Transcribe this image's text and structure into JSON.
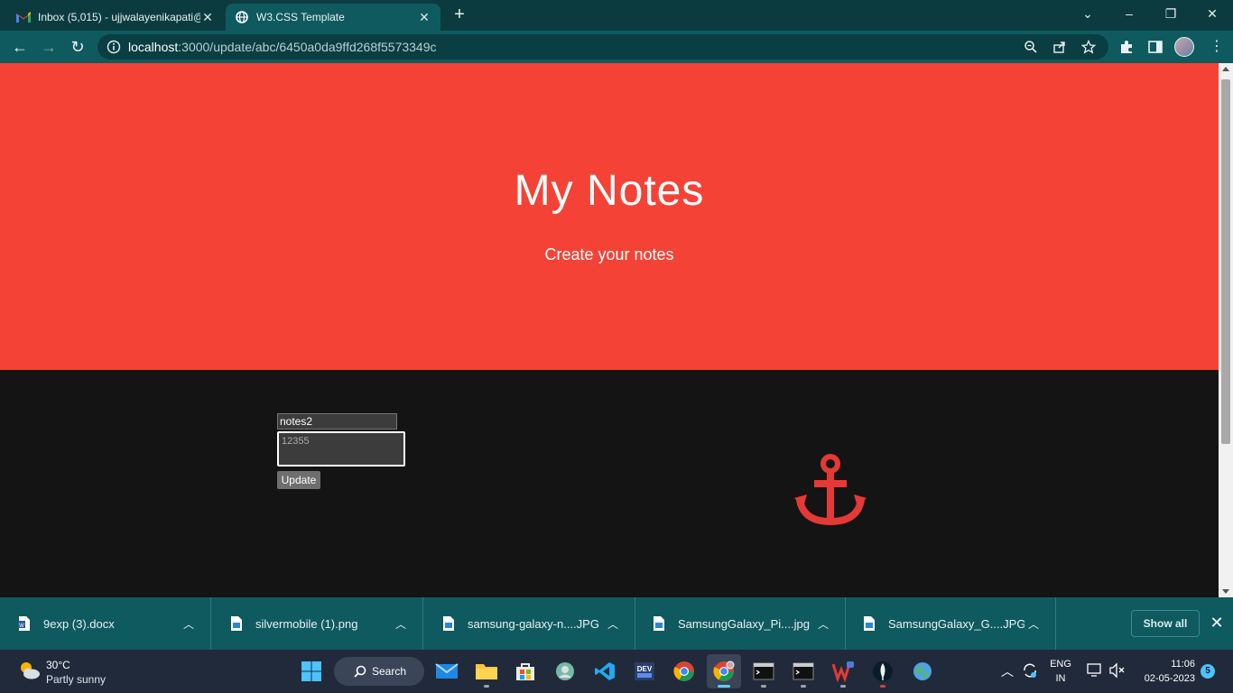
{
  "browser": {
    "tabs": [
      {
        "title": "Inbox (5,015) - ujjwalayenikapati@",
        "favicon": "gmail-icon",
        "active": false
      },
      {
        "title": "W3.CSS Template",
        "favicon": "globe-icon",
        "active": true
      }
    ],
    "url_host": "localhost",
    "url_path": ":3000/update/abc/6450a0da9ffd268f5573349c"
  },
  "page": {
    "hero_title": "My Notes",
    "hero_subtitle": "Create your notes",
    "colors": {
      "hero": "#f44336",
      "content_bg": "#141414",
      "anchor": "#e53935"
    },
    "form": {
      "title_value": "notes2",
      "body_placeholder": "12355",
      "update_label": "Update"
    },
    "decor_icon": "anchor-icon"
  },
  "downloads": {
    "items": [
      {
        "name": "9exp (3).docx",
        "icon": "word-doc-icon"
      },
      {
        "name": "silvermobile (1).png",
        "icon": "image-file-icon"
      },
      {
        "name": "samsung-galaxy-n....JPG",
        "icon": "image-file-icon"
      },
      {
        "name": "SamsungGalaxy_Pi....jpg",
        "icon": "image-file-icon"
      },
      {
        "name": "SamsungGalaxy_G....JPG",
        "icon": "image-file-icon"
      }
    ],
    "show_all_label": "Show all"
  },
  "taskbar": {
    "weather_temp": "30°C",
    "weather_desc": "Partly sunny",
    "search_label": "Search",
    "lang_line1": "ENG",
    "lang_line2": "IN",
    "time": "11:06",
    "date": "02-05-2023",
    "notification_count": "5"
  }
}
